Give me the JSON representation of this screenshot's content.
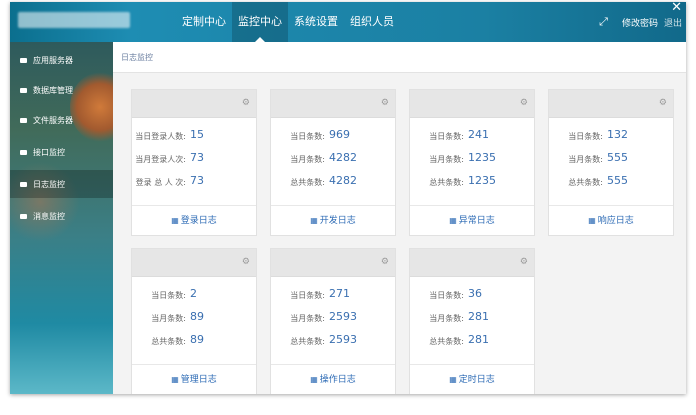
{
  "nav": {
    "items": [
      {
        "label": "定制中心"
      },
      {
        "label": "监控中心"
      },
      {
        "label": "系统设置"
      },
      {
        "label": "组织人员"
      }
    ],
    "change_password": "修改密码",
    "logout": "退出"
  },
  "sidebar": {
    "items": [
      {
        "label": "应用服务器"
      },
      {
        "label": "数据库管理"
      },
      {
        "label": "文件服务器"
      },
      {
        "label": "接口监控"
      },
      {
        "label": "日志监控"
      },
      {
        "label": "消息监控"
      }
    ]
  },
  "breadcrumb": "日志监控",
  "cards": [
    {
      "rows": [
        {
          "label": "当日登录人数:",
          "value": "15"
        },
        {
          "label": "当月登录人次:",
          "value": "73"
        },
        {
          "label": "登录 总 人 次:",
          "value": "73"
        }
      ],
      "footer": "登录日志"
    },
    {
      "rows": [
        {
          "label": "当日条数:",
          "value": "969"
        },
        {
          "label": "当月条数:",
          "value": "4282"
        },
        {
          "label": "总共条数:",
          "value": "4282"
        }
      ],
      "footer": "开发日志"
    },
    {
      "rows": [
        {
          "label": "当日条数:",
          "value": "241"
        },
        {
          "label": "当月条数:",
          "value": "1235"
        },
        {
          "label": "总共条数:",
          "value": "1235"
        }
      ],
      "footer": "异常日志"
    },
    {
      "rows": [
        {
          "label": "当日条数:",
          "value": "132"
        },
        {
          "label": "当月条数:",
          "value": "555"
        },
        {
          "label": "总共条数:",
          "value": "555"
        }
      ],
      "footer": "响应日志"
    },
    {
      "rows": [
        {
          "label": "当日条数:",
          "value": "2"
        },
        {
          "label": "当月条数:",
          "value": "89"
        },
        {
          "label": "总共条数:",
          "value": "89"
        }
      ],
      "footer": "管理日志"
    },
    {
      "rows": [
        {
          "label": "当日条数:",
          "value": "271"
        },
        {
          "label": "当月条数:",
          "value": "2593"
        },
        {
          "label": "总共条数:",
          "value": "2593"
        }
      ],
      "footer": "操作日志"
    },
    {
      "rows": [
        {
          "label": "当日条数:",
          "value": "36"
        },
        {
          "label": "当月条数:",
          "value": "281"
        },
        {
          "label": "总共条数:",
          "value": "281"
        }
      ],
      "footer": "定时日志"
    }
  ],
  "icons": {
    "fullscreen": "fullscreen-icon",
    "gear": "gear-icon",
    "grid": "grid-icon",
    "close": "close-icon"
  },
  "colors": {
    "topbar": "#1c86ab",
    "value_blue": "#3a6fb0",
    "footer_link": "#2d6bb5"
  }
}
